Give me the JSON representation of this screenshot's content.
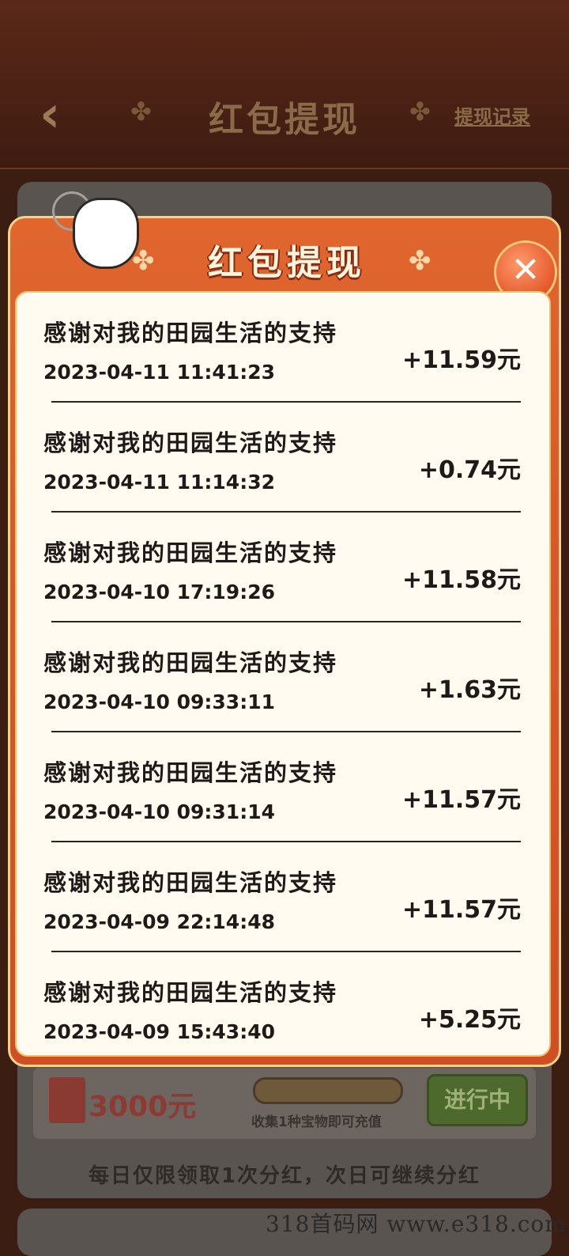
{
  "background": {
    "header": {
      "back_icon": "chevron-left-icon",
      "title": "红包提现",
      "record_link": "提现记录",
      "decor_icon": "four-petal-flower-icon"
    },
    "reward": {
      "amount": "3000元",
      "hint": "收集1种宝物即可充值",
      "status_button": "进行中"
    },
    "notice": "每日仅限领取1次分红，次日可继续分红",
    "watermark": "318首码网   www.e318.com"
  },
  "modal": {
    "title": "红包提现",
    "close_icon": "close-x-icon",
    "records": [
      {
        "title": "感谢对我的田园生活的支持",
        "time": "2023-04-11 11:41:23",
        "amount": "+11.59元"
      },
      {
        "title": "感谢对我的田园生活的支持",
        "time": "2023-04-11 11:14:32",
        "amount": "+0.74元"
      },
      {
        "title": "感谢对我的田园生活的支持",
        "time": "2023-04-10 17:19:26",
        "amount": "+11.58元"
      },
      {
        "title": "感谢对我的田园生活的支持",
        "time": "2023-04-10 09:33:11",
        "amount": "+1.63元"
      },
      {
        "title": "感谢对我的田园生活的支持",
        "time": "2023-04-10 09:31:14",
        "amount": "+11.57元"
      },
      {
        "title": "感谢对我的田园生活的支持",
        "time": "2023-04-09 22:14:48",
        "amount": "+11.57元"
      },
      {
        "title": "感谢对我的田园生活的支持",
        "time": "2023-04-09 15:43:40",
        "amount": "+5.25元"
      }
    ]
  },
  "colors": {
    "modal_orange": "#d7582a",
    "panel_cream": "#fffbf0",
    "border_gold": "#f6d38a",
    "page_brown": "#3b1d12"
  }
}
